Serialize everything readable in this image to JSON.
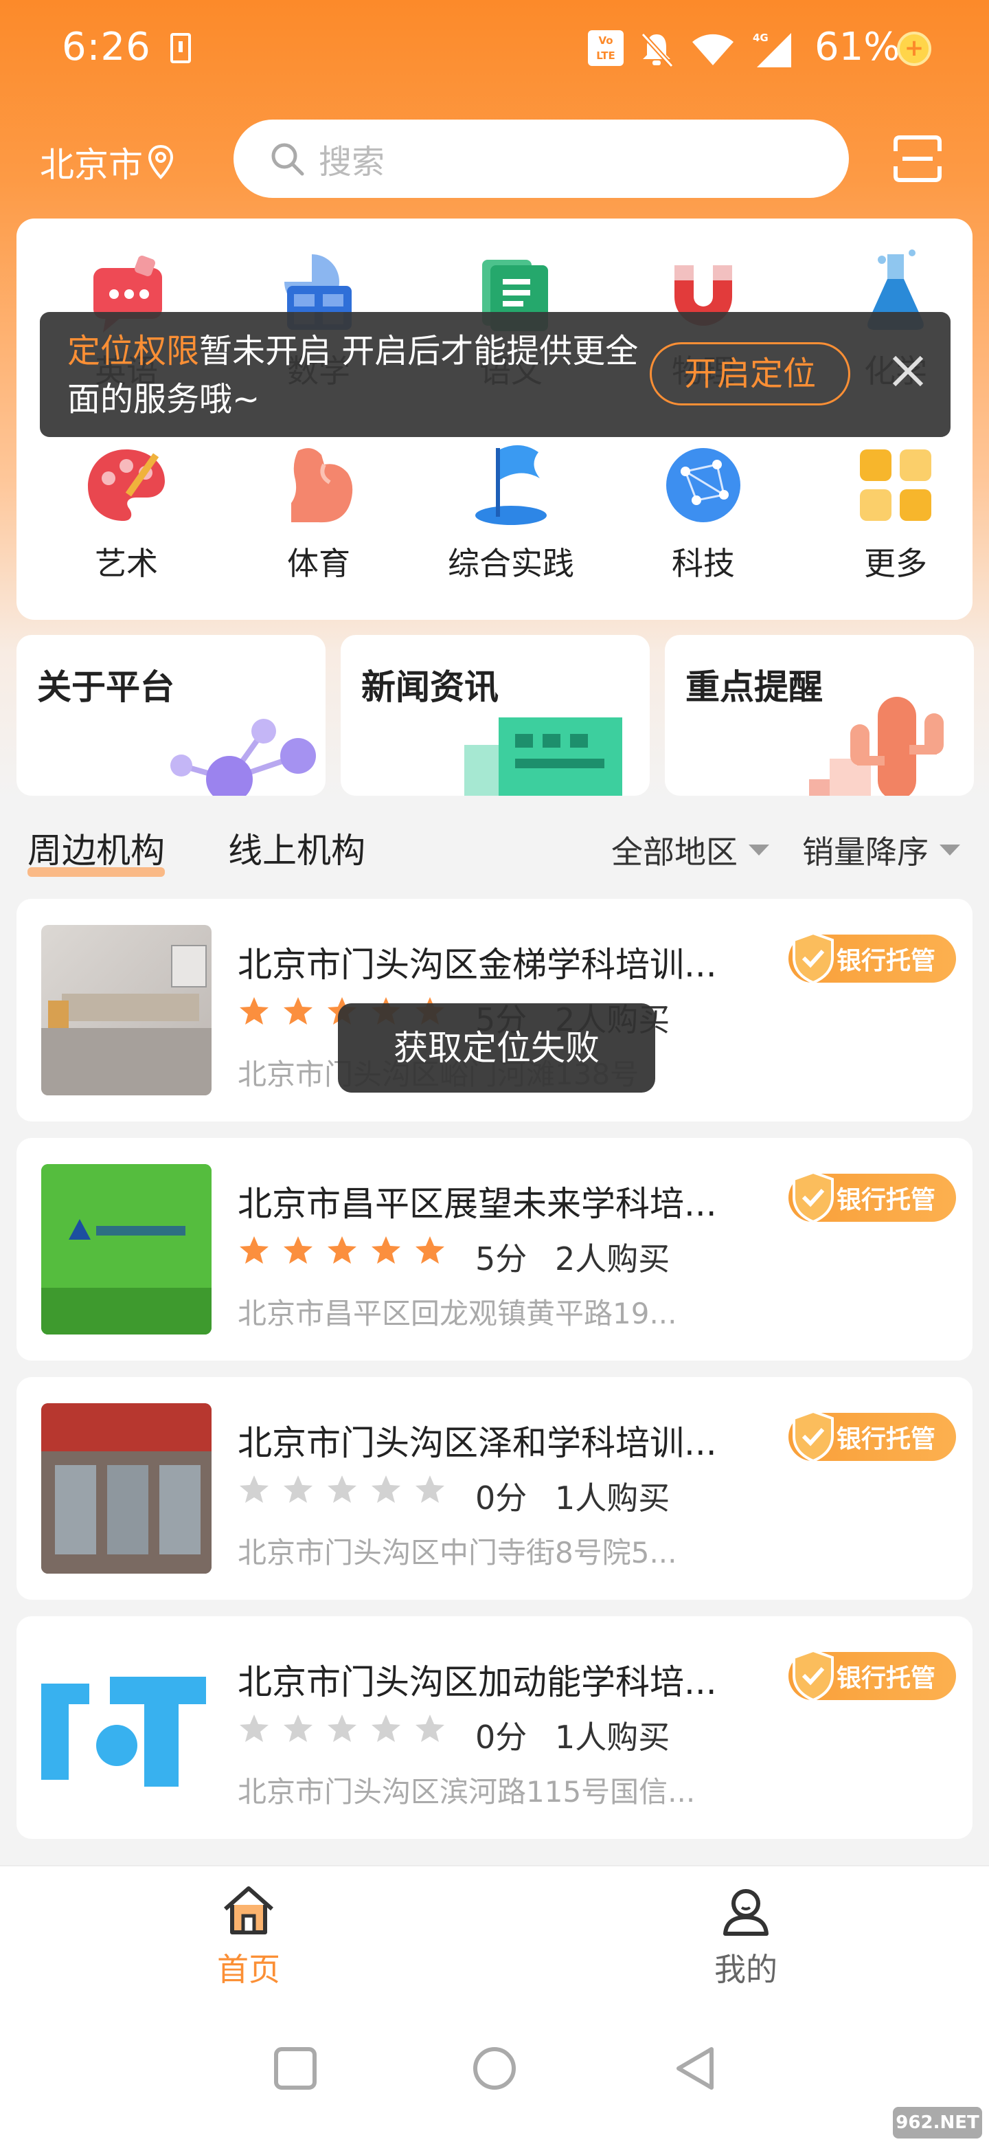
{
  "status_bar": {
    "time": "6:26",
    "volte": "VoLTE",
    "network": "4G",
    "battery": "61%"
  },
  "header": {
    "city": "北京市",
    "search_placeholder": "搜索"
  },
  "categories": [
    {
      "label": "英语",
      "icon": "chat-bubble-icon"
    },
    {
      "label": "数学",
      "icon": "math-shapes-icon"
    },
    {
      "label": "语文",
      "icon": "book-icon"
    },
    {
      "label": "物理",
      "icon": "magnet-icon"
    },
    {
      "label": "化学",
      "icon": "flask-icon"
    },
    {
      "label": "艺术",
      "icon": "palette-icon"
    },
    {
      "label": "体育",
      "icon": "arm-muscle-icon"
    },
    {
      "label": "综合实践",
      "icon": "flag-icon"
    },
    {
      "label": "科技",
      "icon": "network-globe-icon"
    },
    {
      "label": "更多",
      "icon": "grid-more-icon"
    }
  ],
  "location_toast": {
    "highlight": "定位权限",
    "message": "暂未开启 开启后才能提供更全面的服务哦~",
    "button": "开启定位"
  },
  "features": [
    {
      "title": "关于平台"
    },
    {
      "title": "新闻资讯"
    },
    {
      "title": "重点提醒"
    }
  ],
  "tabs": {
    "nearby": "周边机构",
    "online": "线上机构",
    "region_filter": "全部地区",
    "sort_filter": "销量降序"
  },
  "listings": [
    {
      "title": "北京市门头沟区金梯学科培训...",
      "rating": 5,
      "score": "5分",
      "buyers": "2人购买",
      "address": "北京市门头沟区峪门河滩138号",
      "badge": "银行托管"
    },
    {
      "title": "北京市昌平区展望未来学科培...",
      "rating": 5,
      "score": "5分",
      "buyers": "2人购买",
      "address": "北京市昌平区回龙观镇黄平路19...",
      "badge": "银行托管"
    },
    {
      "title": "北京市门头沟区泽和学科培训...",
      "rating": 0,
      "score": "0分",
      "buyers": "1人购买",
      "address": "北京市门头沟区中门寺街8号院5...",
      "badge": "银行托管"
    },
    {
      "title": "北京市门头沟区加动能学科培...",
      "rating": 0,
      "score": "0分",
      "buyers": "1人购买",
      "address": "北京市门头沟区滨河路115号国信...",
      "badge": "银行托管"
    }
  ],
  "fail_toast": "获取定位失败",
  "bottom_nav": {
    "home": "首页",
    "mine": "我的"
  },
  "watermark": "962.NET",
  "colors": {
    "accent": "#fc8a2a",
    "star_on": "#fb8f3e",
    "star_off": "#d2d2d2",
    "badge": "#f9a03a"
  }
}
